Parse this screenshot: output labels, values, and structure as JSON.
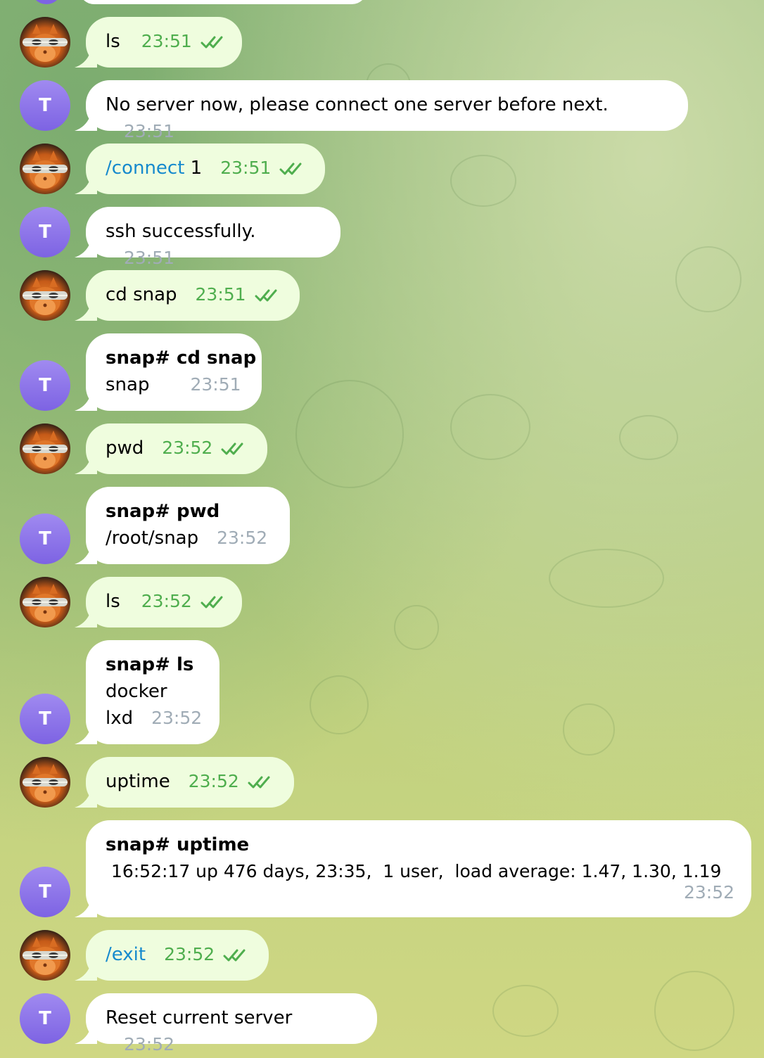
{
  "contacts": {
    "bot_avatar_letter": "T"
  },
  "colors": {
    "outgoing_bubble": "#effdde",
    "incoming_bubble": "#ffffff",
    "outgoing_time": "#4fae4e",
    "incoming_time": "#a0acb6",
    "command_link": "#168acd",
    "bot_avatar": "#7d63e3"
  },
  "messages": [
    {
      "dir": "out",
      "text": "ls",
      "time": "23:51"
    },
    {
      "dir": "in",
      "text": "No server now, please connect one server before next.",
      "time": "23:51"
    },
    {
      "dir": "out",
      "command": "/connect",
      "arg": " 1",
      "time": "23:51"
    },
    {
      "dir": "in",
      "text": "ssh successfully.",
      "time": "23:51"
    },
    {
      "dir": "out",
      "text": "cd snap",
      "time": "23:51"
    },
    {
      "dir": "in",
      "header": "snap# cd snap",
      "lines": [
        "snap"
      ],
      "time": "23:51"
    },
    {
      "dir": "out",
      "text": "pwd",
      "time": "23:52"
    },
    {
      "dir": "in",
      "header": "snap# pwd",
      "lines": [
        "/root/snap"
      ],
      "time": "23:52"
    },
    {
      "dir": "out",
      "text": "ls",
      "time": "23:52"
    },
    {
      "dir": "in",
      "header": "snap# ls",
      "lines": [
        "docker",
        "lxd"
      ],
      "time": "23:52"
    },
    {
      "dir": "out",
      "text": "uptime",
      "time": "23:52"
    },
    {
      "dir": "in",
      "header": "snap# uptime",
      "lines": [
        " 16:52:17 up 476 days, 23:35,  1 user,  load average: 1.47, 1.30, 1.19"
      ],
      "time": "23:52"
    },
    {
      "dir": "out",
      "command": "/exit",
      "time": "23:52"
    },
    {
      "dir": "in",
      "text": "Reset current server",
      "time": "23:52"
    }
  ]
}
